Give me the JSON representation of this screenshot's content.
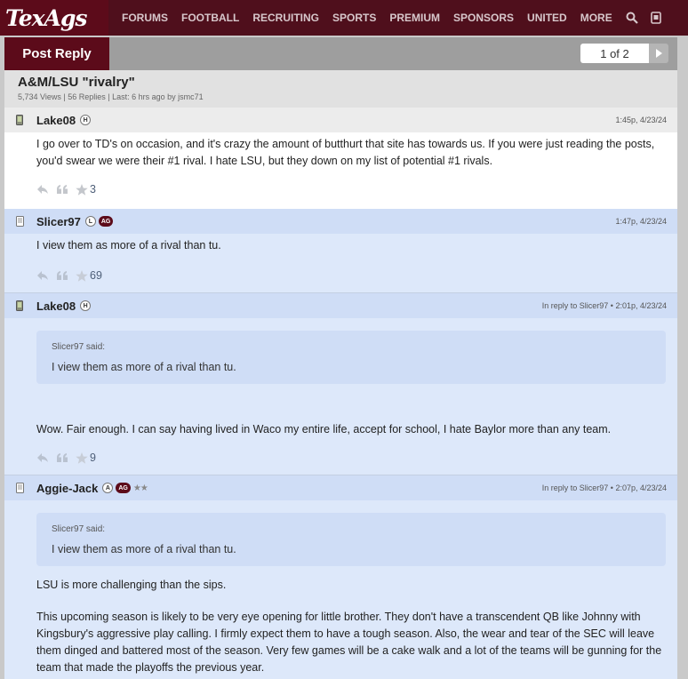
{
  "brand": {
    "logo_text": "TexAgs"
  },
  "nav": {
    "items": [
      "FORUMS",
      "FOOTBALL",
      "RECRUITING",
      "SPORTS",
      "PREMIUM",
      "SPONSORS",
      "UNITED",
      "MORE"
    ]
  },
  "thread": {
    "post_reply_label": "Post Reply",
    "pager_text": "1 of 2",
    "title": "A&M/LSU \"rivalry\"",
    "meta": "5,734 Views | 56 Replies | Last: 6 hrs ago by jsmc71"
  },
  "posts": [
    {
      "username": "Lake08",
      "badge": "H",
      "time": "1:45p, 4/23/24",
      "body": "I go over to TD's on occasion, and it's crazy the amount of butthurt that site has towards us. If you were just reading the posts, you'd swear we were their #1 rival. I hate LSU, but they down on my list of potential #1 rivals.",
      "likes": "3"
    },
    {
      "username": "Slicer97",
      "badge": "L",
      "ag_badge": "AG",
      "time": "1:47p, 4/23/24",
      "body": "I view them as more of a rival than tu.",
      "likes": "69"
    },
    {
      "username": "Lake08",
      "badge": "H",
      "time": "In reply to Slicer97 • 2:01p, 4/23/24",
      "quote_author": "Slicer97 said:",
      "quote_text": "I view them as more of a rival than tu.",
      "body": "Wow. Fair enough. I can say having lived in Waco my entire life, accept for school, I hate Baylor more than any team.",
      "likes": "9"
    },
    {
      "username": "Aggie-Jack",
      "badge": "A",
      "ag_badge": "AG",
      "stars": "★★",
      "time": "In reply to Slicer97 • 2:07p, 4/23/24",
      "quote_author": "Slicer97 said:",
      "quote_text": "I view them as more of a rival than tu.",
      "body": "LSU is more challenging than the sips.",
      "body2": "This upcoming season is likely to be very eye opening for little brother. They don't have a transcendent QB like Johnny with Kingsbury's aggressive play calling. I firmly expect them to have a tough season. Also, the wear and tear of the SEC will leave them dinged and battered most of the season. Very few games will be a cake walk and a lot of the teams will be gunning for the team that made the playoffs the previous year."
    }
  ],
  "icons": {
    "search": "search-icon",
    "app": "app-icon",
    "reply": "reply-icon",
    "quote": "quote-icon",
    "star": "star-icon",
    "mobile": "mobile-device-icon",
    "desktop": "desktop-device-icon"
  },
  "colors": {
    "brand_maroon": "#5c0b1a",
    "nav_bg": "#4f0f1c",
    "post_blue": "#dde8fa",
    "post_head_blue": "#cfddf6"
  }
}
